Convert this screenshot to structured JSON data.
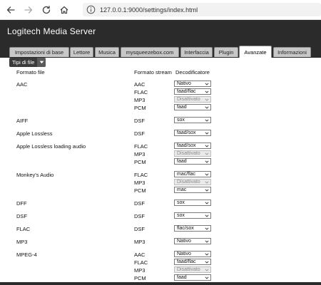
{
  "browser": {
    "url": "127.0.0.1:9000/settings/index.html"
  },
  "app": {
    "title": "Logitech Media Server"
  },
  "tabs": [
    {
      "label": "Impostazioni di base"
    },
    {
      "label": "Lettore"
    },
    {
      "label": "Musica"
    },
    {
      "label": "mysqueezebox.com"
    },
    {
      "label": "Interfaccia"
    },
    {
      "label": "Plugin"
    },
    {
      "label": "Avanzate",
      "active": true
    },
    {
      "label": "Informazioni"
    }
  ],
  "toolbar": {
    "file_types_label": "Tipi di file"
  },
  "table": {
    "headers": {
      "format": "Formato file",
      "stream": "Formato stream",
      "decoder": "Decodificatore"
    },
    "groups": [
      {
        "format": "AAC",
        "streams": [
          {
            "stream": "AAC",
            "decoder": "Nativo",
            "disabled": false
          },
          {
            "stream": "FLAC",
            "decoder": "faad/flac",
            "disabled": false
          },
          {
            "stream": "MP3",
            "decoder": "Disattivato",
            "disabled": true
          },
          {
            "stream": "PCM",
            "decoder": "faad",
            "disabled": false
          }
        ]
      },
      {
        "format": "AIFF",
        "streams": [
          {
            "stream": "DSF",
            "decoder": "sox",
            "disabled": false
          }
        ]
      },
      {
        "format": "Apple Lossless",
        "streams": [
          {
            "stream": "DSF",
            "decoder": "faad/sox",
            "disabled": false
          }
        ]
      },
      {
        "format": "Apple Lossless loading audio",
        "streams": [
          {
            "stream": "FLAC",
            "decoder": "faad/sox",
            "disabled": false
          },
          {
            "stream": "MP3",
            "decoder": "Disattivato",
            "disabled": true
          },
          {
            "stream": "PCM",
            "decoder": "faad",
            "disabled": false
          }
        ]
      },
      {
        "format": "Monkey's Audio",
        "streams": [
          {
            "stream": "FLAC",
            "decoder": "mac/flac",
            "disabled": false
          },
          {
            "stream": "MP3",
            "decoder": "Disattivato",
            "disabled": true
          },
          {
            "stream": "PCM",
            "decoder": "mac",
            "disabled": false
          }
        ]
      },
      {
        "format": "DFF",
        "streams": [
          {
            "stream": "DSF",
            "decoder": "sox",
            "disabled": false
          }
        ]
      },
      {
        "format": "DSF",
        "streams": [
          {
            "stream": "DSF",
            "decoder": "sox",
            "disabled": false
          }
        ]
      },
      {
        "format": "FLAC",
        "streams": [
          {
            "stream": "DSF",
            "decoder": "flac/sox",
            "disabled": false
          }
        ]
      },
      {
        "format": "MP3",
        "streams": [
          {
            "stream": "MP3",
            "decoder": "Nativo",
            "disabled": false
          }
        ]
      },
      {
        "format": "MPEG-4",
        "streams": [
          {
            "stream": "AAC",
            "decoder": "Nativo",
            "disabled": false
          },
          {
            "stream": "FLAC",
            "decoder": "faad/flac",
            "disabled": false
          },
          {
            "stream": "MP3",
            "decoder": "Disattivato",
            "disabled": true
          },
          {
            "stream": "PCM",
            "decoder": "faad",
            "disabled": false
          }
        ]
      }
    ]
  },
  "icons": {
    "back": "arrow-left-icon",
    "forward": "arrow-right-icon",
    "reload": "reload-icon",
    "home": "home-icon",
    "info": "info-icon",
    "dropdown": "chevron-down-icon"
  },
  "colors": {
    "header_bg": "#2b2b2b",
    "tab_bg": "#c8c8c8",
    "active_tab_bg": "#ffffff",
    "disabled_select_bg": "#eaeaea"
  }
}
